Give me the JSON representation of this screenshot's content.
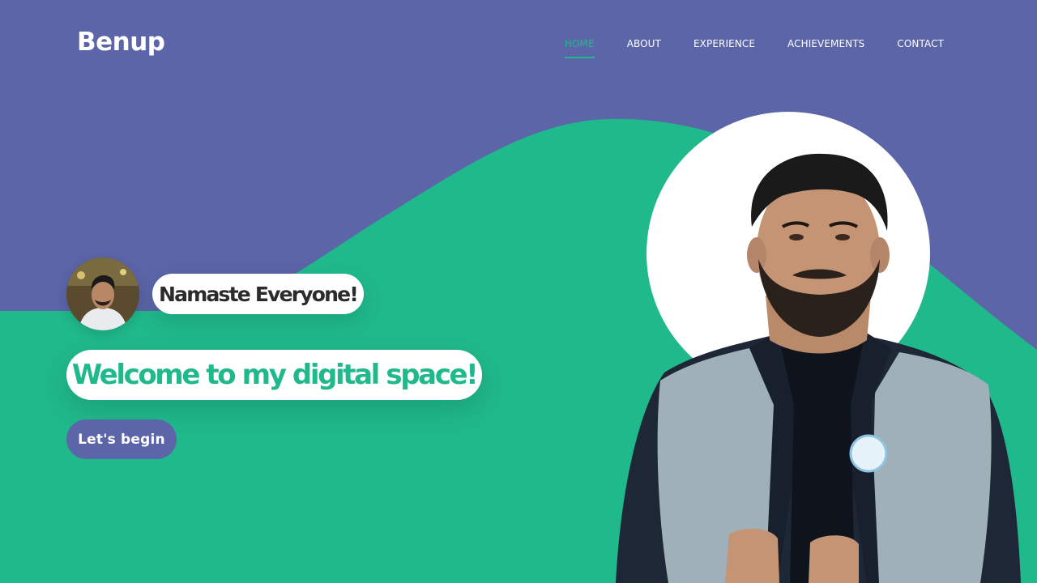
{
  "brand": {
    "name": "Benup"
  },
  "nav": {
    "items": [
      {
        "label": "HOME",
        "active": true
      },
      {
        "label": "ABOUT",
        "active": false
      },
      {
        "label": "EXPERIENCE",
        "active": false
      },
      {
        "label": "ACHIEVEMENTS",
        "active": false
      },
      {
        "label": "CONTACT",
        "active": false
      }
    ]
  },
  "hero": {
    "greeting": "Namaste Everyone!",
    "headline": "Welcome to my digital space!",
    "cta_label": "Let's begin"
  },
  "colors": {
    "primary": "#5b65a7",
    "accent": "#20b98c",
    "surface": "#ffffff",
    "text_dark": "#2b2b2b"
  }
}
